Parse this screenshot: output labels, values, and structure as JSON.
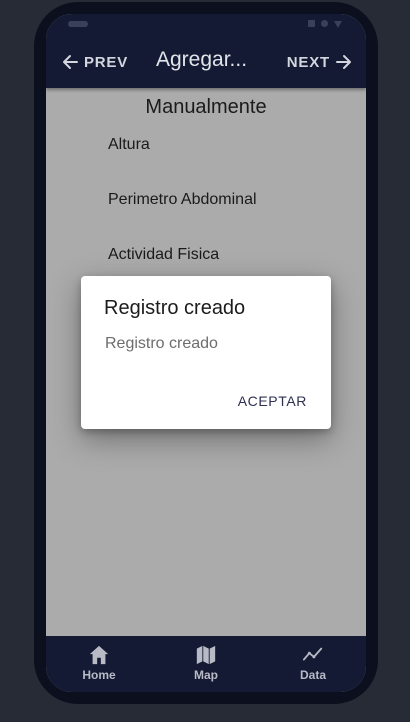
{
  "appbar": {
    "prev_label": "PREV",
    "title": "Agregar...",
    "next_label": "NEXT"
  },
  "content": {
    "title": "Manualmente",
    "fields": [
      "Altura",
      "Perimetro Abdominal",
      "Actividad Fisica"
    ]
  },
  "dialog": {
    "title": "Registro creado",
    "message": "Registro creado",
    "button_label": "ACEPTAR"
  },
  "tabbar": {
    "items": [
      {
        "label": "Home",
        "icon": "home-icon"
      },
      {
        "label": "Map",
        "icon": "map-icon"
      },
      {
        "label": "Data",
        "icon": "chart-line-icon"
      }
    ]
  },
  "colors": {
    "appbar_bg": "#141a33",
    "screen_bg": "#ababab",
    "dialog_button": "#2f3050"
  }
}
